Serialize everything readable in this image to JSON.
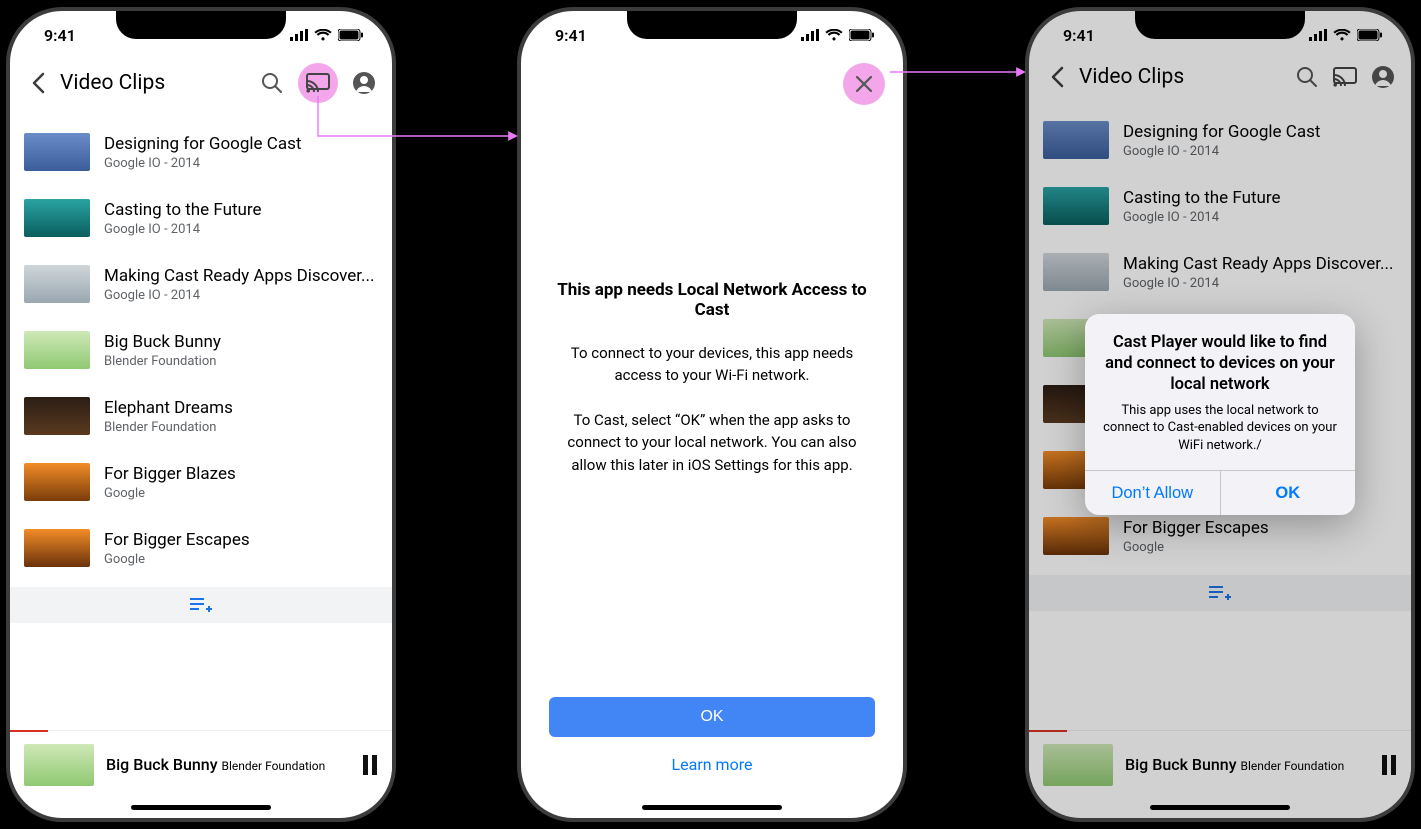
{
  "status": {
    "time": "9:41"
  },
  "appbar": {
    "title": "Video Clips"
  },
  "videos": [
    {
      "title": "Designing for Google Cast",
      "subtitle": "Google IO - 2014"
    },
    {
      "title": "Casting to the Future",
      "subtitle": "Google IO - 2014"
    },
    {
      "title": "Making Cast Ready Apps Discover...",
      "subtitle": "Google IO - 2014"
    },
    {
      "title": "Big Buck Bunny",
      "subtitle": "Blender Foundation"
    },
    {
      "title": "Elephant Dreams",
      "subtitle": "Blender Foundation"
    },
    {
      "title": "For Bigger Blazes",
      "subtitle": "Google"
    },
    {
      "title": "For Bigger Escapes",
      "subtitle": "Google"
    }
  ],
  "now_playing": {
    "title": "Big Buck Bunny",
    "subtitle": "Blender Foundation"
  },
  "info": {
    "heading": "This app needs Local Network Access to Cast",
    "para1": "To connect to your devices, this app needs access to your Wi-Fi network.",
    "para2": "To Cast, select “OK” when the app asks to connect to your local network. You can also allow this later in iOS Settings for this app.",
    "ok": "OK",
    "learn": "Learn more"
  },
  "alert": {
    "title": "Cast Player would like to find and connect to devices on your local network",
    "body": "This app uses the local network to connect to Cast-enabled devices on your WiFi network./",
    "deny": "Don’t Allow",
    "ok": "OK"
  }
}
